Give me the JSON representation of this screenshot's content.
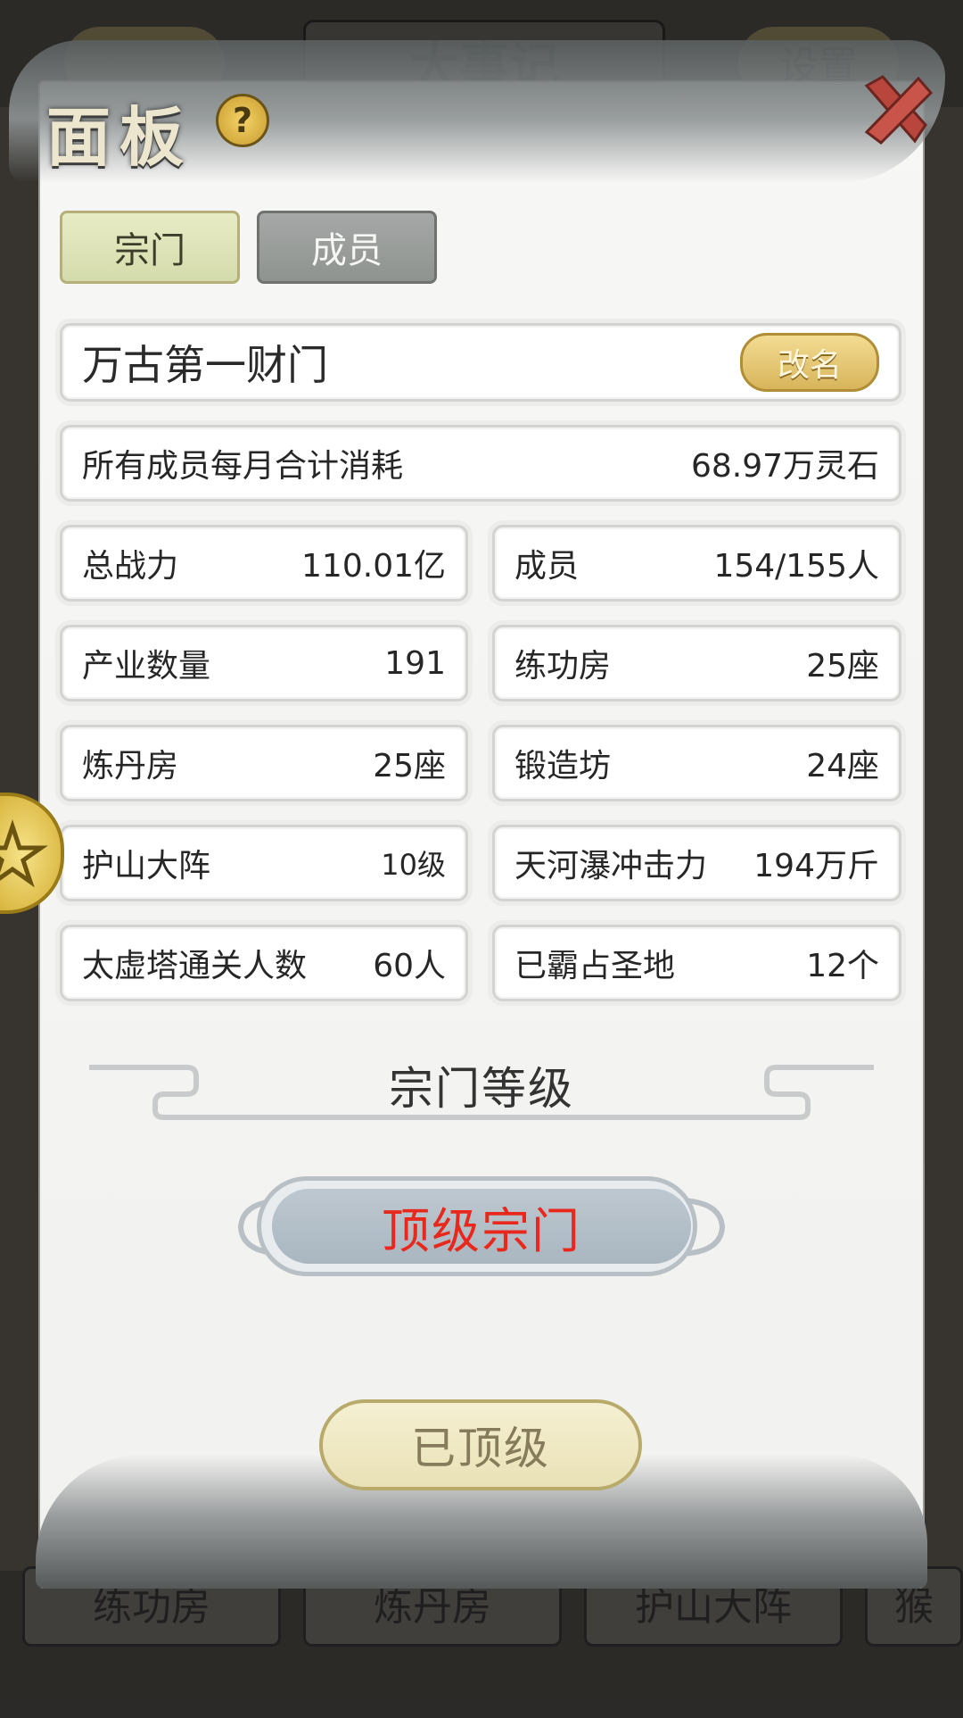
{
  "background": {
    "top_title": "大事记",
    "top_right_button": "设置",
    "bottom_buttons": [
      "练功房",
      "炼丹房",
      "护山大阵",
      "猴"
    ]
  },
  "panel": {
    "title": "面板",
    "help_icon": "help-icon",
    "close_icon": "close-icon"
  },
  "tabs": [
    {
      "label": "宗门",
      "active": true
    },
    {
      "label": "成员",
      "active": false
    }
  ],
  "sect": {
    "name": "万古第一财门",
    "rename_label": "改名"
  },
  "monthly_cost": {
    "label": "所有成员每月合计消耗",
    "value": "68.97万灵石"
  },
  "stats": [
    {
      "label": "总战力",
      "value": "110.01亿"
    },
    {
      "label": "成员",
      "value": "154/155人"
    },
    {
      "label": "产业数量",
      "value": "191"
    },
    {
      "label": "练功房",
      "value": "25座"
    },
    {
      "label": "炼丹房",
      "value": "25座"
    },
    {
      "label": "锻造坊",
      "value": "24座"
    },
    {
      "label": "护山大阵",
      "value": "10级"
    },
    {
      "label": "天河瀑冲击力",
      "value": "194万斤"
    },
    {
      "label": "太虚塔通关人数",
      "value": "60人"
    },
    {
      "label": "已霸占圣地",
      "value": "12个"
    }
  ],
  "level_section": {
    "heading": "宗门等级",
    "rank": "顶级宗门",
    "button_label": "已顶级"
  },
  "colors": {
    "rank_text": "#e8281c",
    "tab_active": "#d4dbab",
    "tab_inactive": "#8f9390",
    "gold": "#d8b55b"
  }
}
